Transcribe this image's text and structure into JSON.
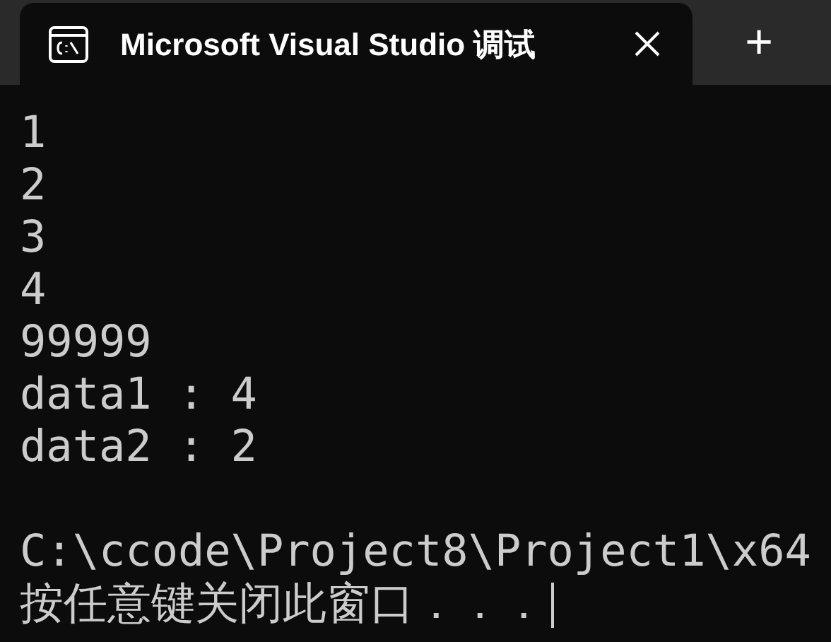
{
  "tab": {
    "title": "Microsoft Visual Studio 调试",
    "selected": true
  },
  "new_tab": "+",
  "output_lines": [
    "1",
    "2",
    "3",
    "4",
    "99999",
    "data1 : 4",
    "data2 : 2"
  ],
  "path_line": "C:\\ccode\\Project8\\Project1\\x64",
  "prompt": "按任意键关闭此窗口．．．"
}
